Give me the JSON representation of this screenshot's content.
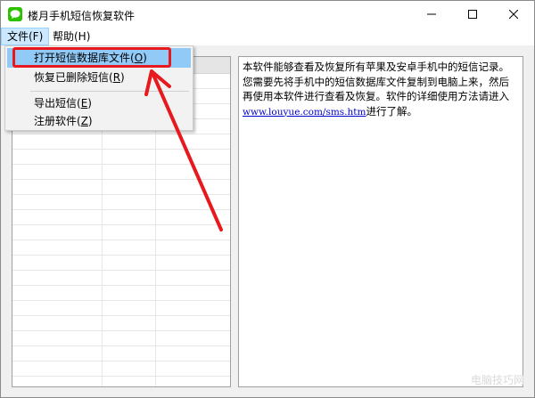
{
  "window": {
    "title": "楼月手机短信恢复软件",
    "icon": "chat-bubble-icon"
  },
  "menubar": {
    "file_label": "文件(F)",
    "help_label": "帮助(H)"
  },
  "file_menu": {
    "items": [
      {
        "label": "打开短信数据库文件(",
        "key": "O",
        "suffix": ")"
      },
      {
        "label": "恢复已删除短信(",
        "key": "R",
        "suffix": ")"
      },
      {
        "label": "导出短信(",
        "key": "E",
        "suffix": ")"
      },
      {
        "label": "注册软件(",
        "key": "Z",
        "suffix": ")"
      }
    ]
  },
  "info_panel": {
    "line1": "本软件能够查看及恢复所有苹果及安卓手机中的短信记录。",
    "line2": "您需要先将手机中的短信数据库文件复制到电脑上来，然后",
    "line3": "再使用本软件进行查看及恢复。软件的详细使用方法请进入",
    "link": "www.louyue.com/sms.htm",
    "line4_suffix": "进行了解。"
  },
  "watermark": "电脑技巧网",
  "colors": {
    "highlight": "#e8191e",
    "menu_active": "#91c9f7",
    "link": "#0000cc",
    "app_icon": "#2dc100"
  }
}
